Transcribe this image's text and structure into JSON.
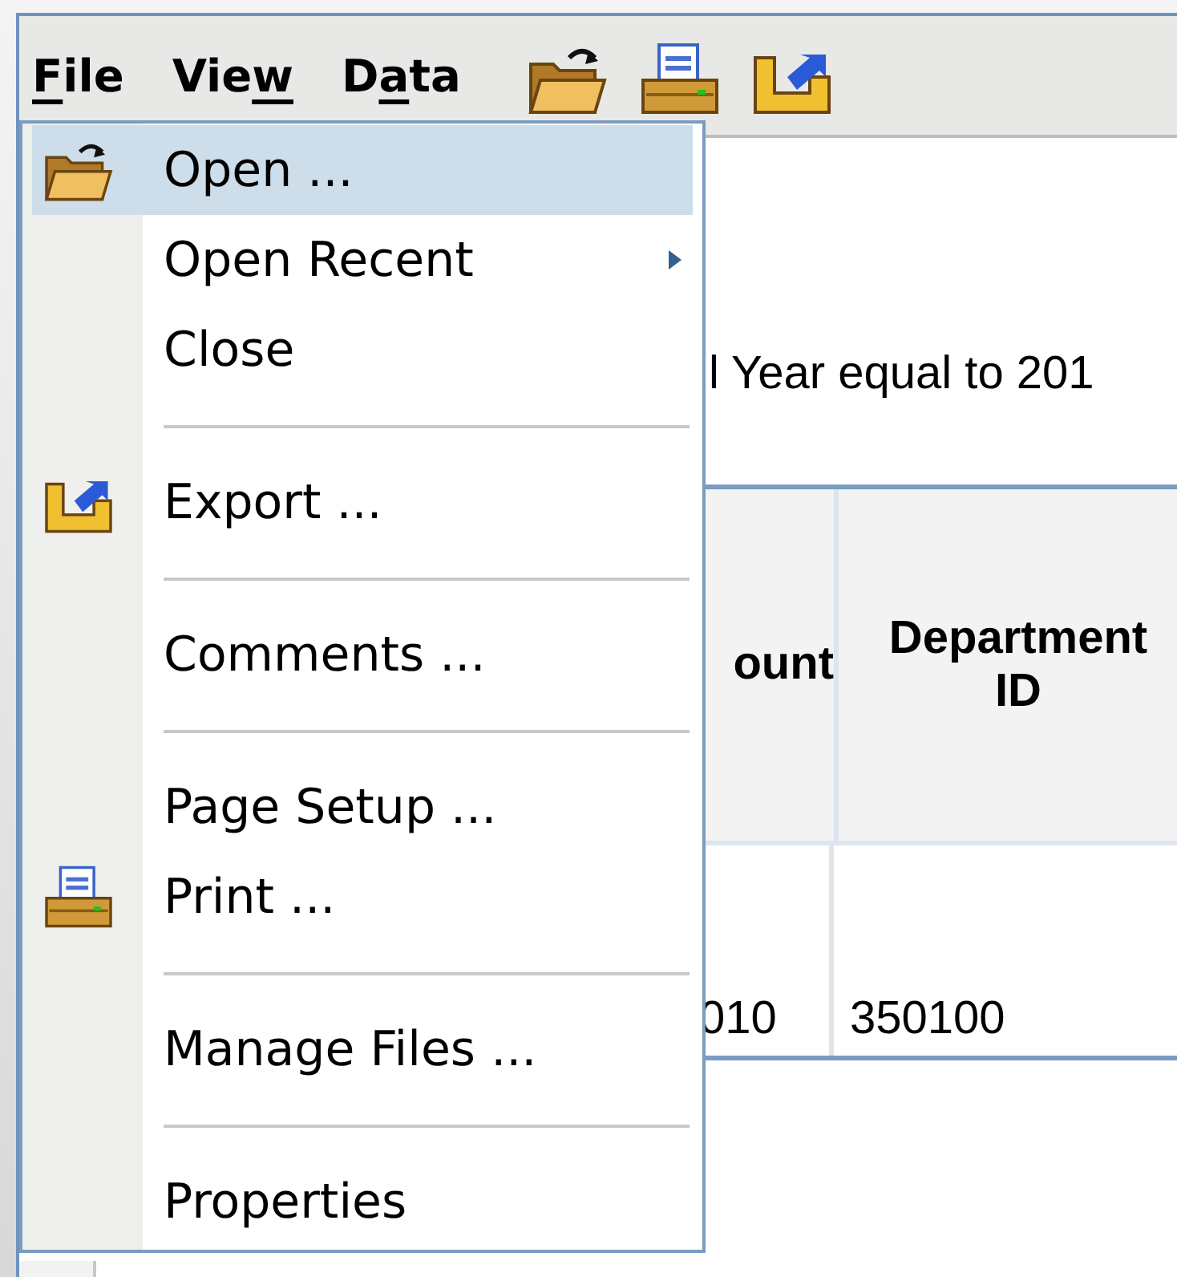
{
  "menubar": {
    "menus": [
      {
        "underlined": "F",
        "after": "ile"
      },
      {
        "before": "Vie",
        "underlined": "w"
      },
      {
        "before": "D",
        "underlined": "a",
        "after": "ta"
      }
    ]
  },
  "toolbar": {
    "buttons": [
      {
        "kind": "open"
      },
      {
        "kind": "print"
      },
      {
        "kind": "export"
      }
    ]
  },
  "file_menu": {
    "items": [
      {
        "kind": "open",
        "label": "Open ...",
        "selected": true
      },
      {
        "kind": "submenu",
        "label": "Open Recent",
        "selected": false
      },
      {
        "kind": "item",
        "label": "Close",
        "selected": false
      },
      {
        "kind": "separator"
      },
      {
        "kind": "export",
        "label": "Export ...",
        "selected": false
      },
      {
        "kind": "separator"
      },
      {
        "kind": "item",
        "label": "Comments ...",
        "selected": false
      },
      {
        "kind": "separator"
      },
      {
        "kind": "item",
        "label": "Page Setup ...",
        "selected": false
      },
      {
        "kind": "print",
        "label": "Print ...",
        "selected": false
      },
      {
        "kind": "separator"
      },
      {
        "kind": "item",
        "label": "Manage Files ...",
        "selected": false
      },
      {
        "kind": "separator"
      },
      {
        "kind": "item",
        "label": "Properties",
        "selected": false
      }
    ]
  },
  "report": {
    "filter_text": "l Year equal to 201",
    "table": {
      "columns": [
        "ount",
        "Department\nID"
      ],
      "rows": [
        [
          "010",
          "350100"
        ]
      ]
    }
  }
}
